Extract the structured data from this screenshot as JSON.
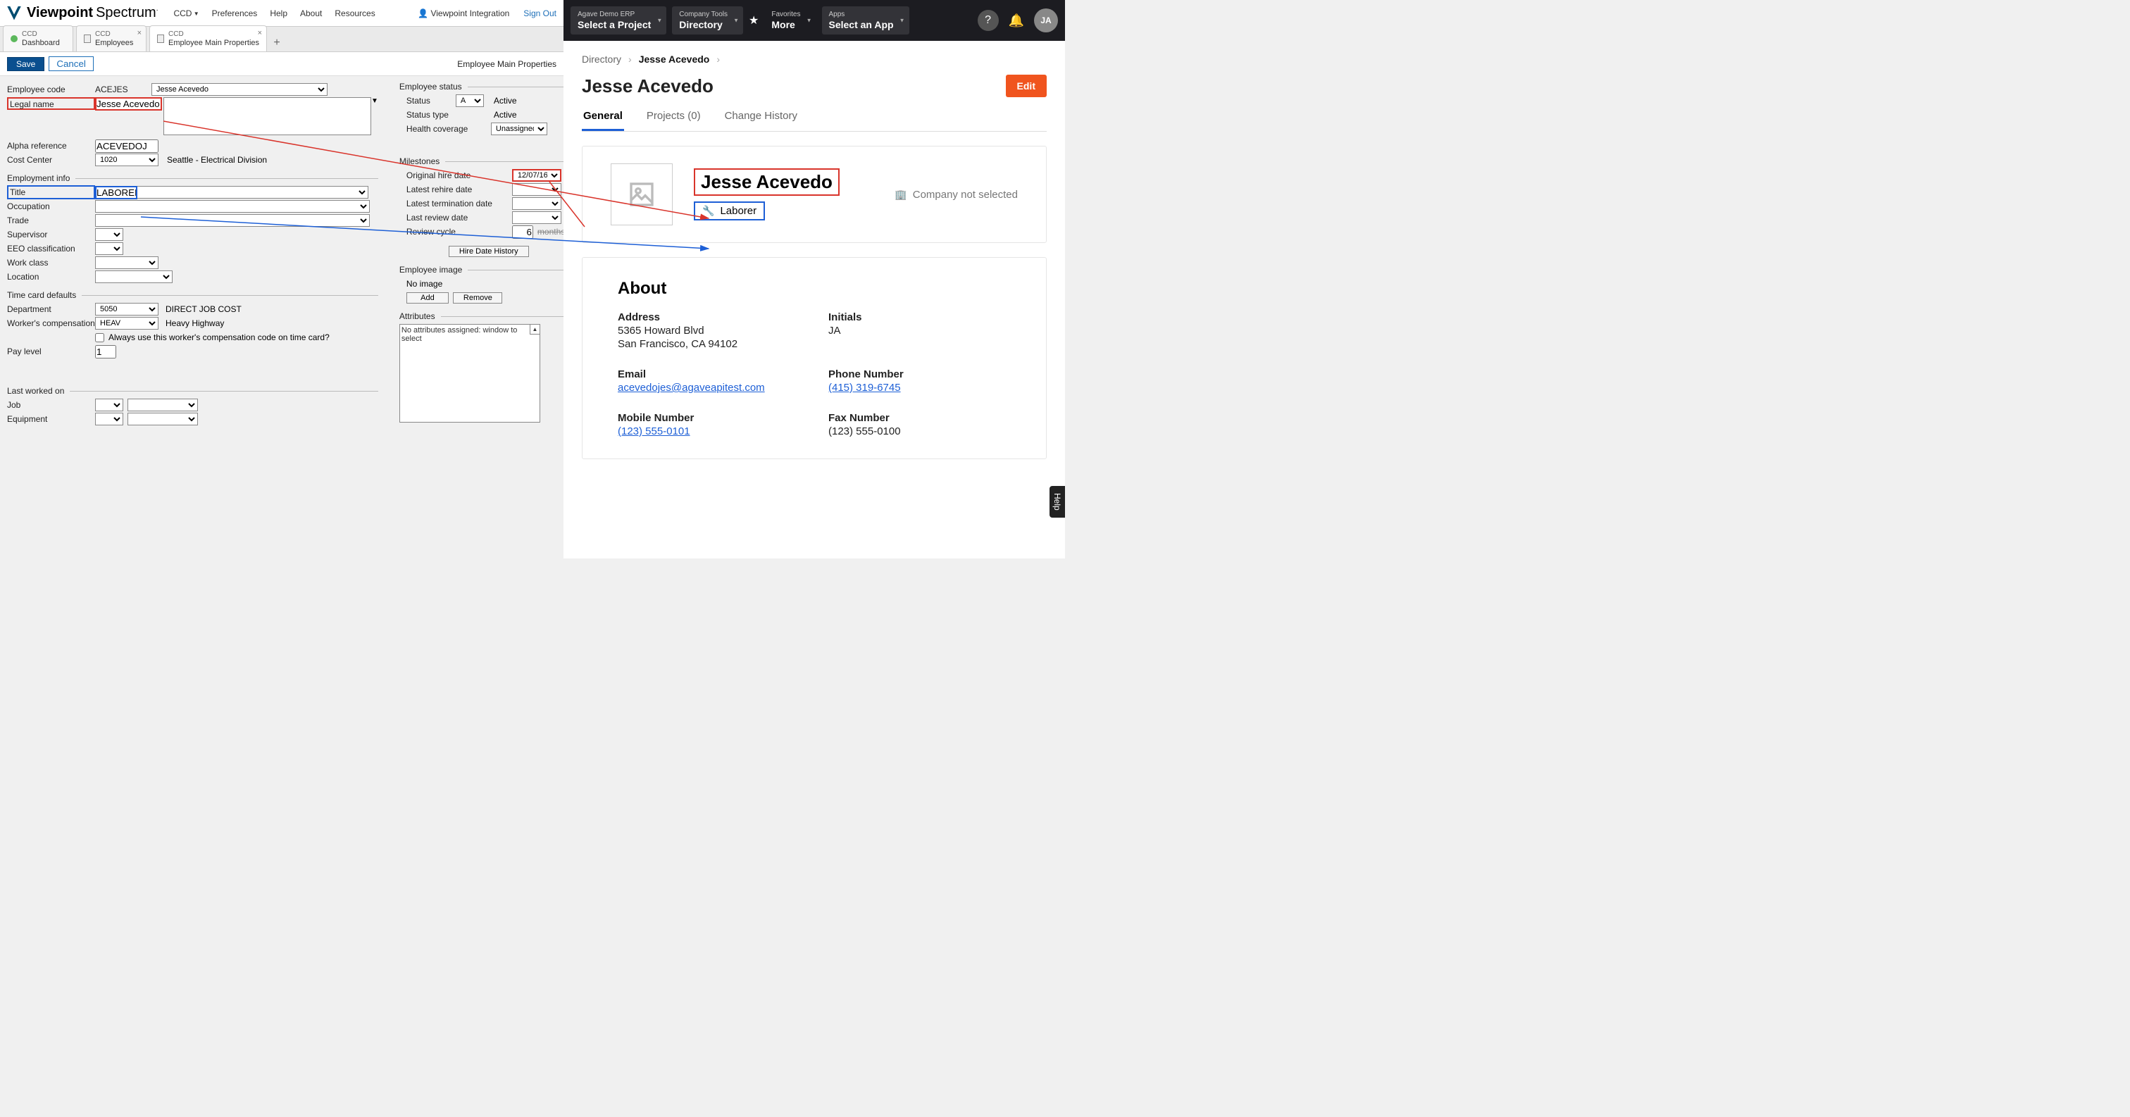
{
  "leftApp": {
    "brand1": "Viewpoint",
    "brand2": "Spectrum",
    "menu": {
      "ccd": "CCD",
      "prefs": "Preferences",
      "help": "Help",
      "about": "About",
      "resources": "Resources"
    },
    "userMenu": "Viewpoint Integration",
    "signout": "Sign Out",
    "tabs": [
      {
        "small": "CCD",
        "label": "Dashboard"
      },
      {
        "small": "CCD",
        "label": "Employees"
      },
      {
        "small": "CCD",
        "label": "Employee Main Properties"
      }
    ],
    "save": "Save",
    "cancel": "Cancel",
    "pageTitle": "Employee Main Properties",
    "fields": {
      "employeeCodeLabel": "Employee code",
      "employeeCode": "ACEJES",
      "employeeName": "Jesse Acevedo",
      "legalNameLabel": "Legal name",
      "legalName": "Jesse Acevedo",
      "alphaRefLabel": "Alpha reference",
      "alphaRef": "ACEVEDOJ",
      "costCenterLabel": "Cost Center",
      "costCenter": "1020",
      "costCenterDesc": "Seattle - Electrical Division",
      "employmentInfo": "Employment info",
      "titleLabel": "Title",
      "title": "LABORER",
      "occupationLabel": "Occupation",
      "tradeLabel": "Trade",
      "supervisorLabel": "Supervisor",
      "eeoLabel": "EEO classification",
      "workClassLabel": "Work class",
      "locationLabel": "Location",
      "timeCard": "Time card defaults",
      "deptLabel": "Department",
      "dept": "5050",
      "deptDesc": "DIRECT JOB COST",
      "wcLabel": "Worker's compensation",
      "wc": "HEAV",
      "wcDesc": "Heavy Highway",
      "wcCheckbox": "Always use this worker's compensation code on time card?",
      "payLabel": "Pay level",
      "pay": "1",
      "lastWorked": "Last worked on",
      "jobLabel": "Job",
      "equipLabel": "Equipment",
      "statusHdr": "Employee status",
      "statusLabel": "Status",
      "status": "A",
      "statusVal": "Active",
      "statusTypeLabel": "Status type",
      "statusType": "Active",
      "healthLabel": "Health coverage",
      "health": "Unassigned",
      "milestones": "Milestones",
      "origHireLabel": "Original hire date",
      "origHire": "12/07/16",
      "rehireLabel": "Latest rehire date",
      "termLabel": "Latest termination date",
      "reviewLabel": "Last review date",
      "cycleLabel": "Review cycle",
      "cycle": "6",
      "months": "months",
      "hireHist": "Hire Date History",
      "empImage": "Employee image",
      "noImage": "No image",
      "add": "Add",
      "remove": "Remove",
      "attributes": "Attributes",
      "attrText": "No attributes assigned: window to select"
    }
  },
  "rightApp": {
    "nav": {
      "proj": {
        "small": "Agave Demo ERP",
        "big": "Select a Project"
      },
      "tools": {
        "small": "Company Tools",
        "big": "Directory"
      },
      "fav": {
        "small": "Favorites",
        "big": "More"
      },
      "apps": {
        "small": "Apps",
        "big": "Select an App"
      }
    },
    "avatar": "JA",
    "crumb1": "Directory",
    "crumb2": "Jesse Acevedo",
    "title": "Jesse Acevedo",
    "edit": "Edit",
    "tabs": {
      "general": "General",
      "projects": "Projects (0)",
      "history": "Change History"
    },
    "profile": {
      "name": "Jesse Acevedo",
      "role": "Laborer",
      "company": "Company not selected"
    },
    "about": {
      "hdr": "About",
      "addressLabel": "Address",
      "address1": "5365 Howard Blvd",
      "address2": "San Francisco, CA 94102",
      "initialsLabel": "Initials",
      "initials": "JA",
      "emailLabel": "Email",
      "email": "acevedojes@agaveapitest.com",
      "phoneLabel": "Phone Number",
      "phone": "(415) 319-6745",
      "mobileLabel": "Mobile Number",
      "mobile": "(123) 555-0101",
      "faxLabel": "Fax Number",
      "fax": "(123) 555-0100"
    },
    "help": "Help"
  }
}
